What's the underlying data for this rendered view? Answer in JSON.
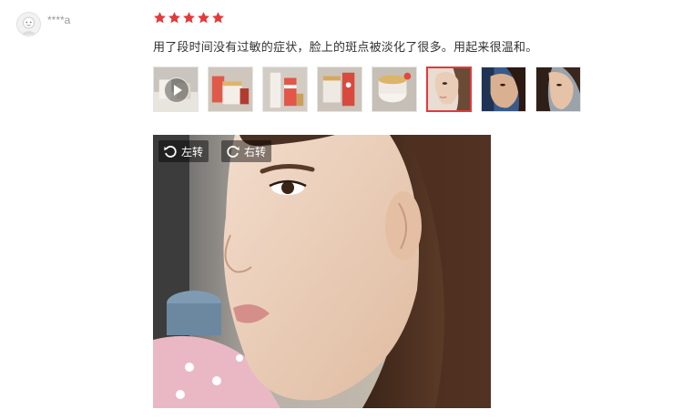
{
  "review": {
    "username": "****a",
    "rating": 5,
    "max_rating": 5,
    "star_color": "#e4393c",
    "comment": "用了段时间没有过敏的症状，脸上的斑点被淡化了很多。用起来很温和。",
    "thumbnails": [
      {
        "name": "thumb-video",
        "kind": "video"
      },
      {
        "name": "thumb-product-1",
        "kind": "image"
      },
      {
        "name": "thumb-product-2",
        "kind": "image"
      },
      {
        "name": "thumb-product-3",
        "kind": "image"
      },
      {
        "name": "thumb-product-4",
        "kind": "image"
      },
      {
        "name": "thumb-face-1",
        "kind": "image",
        "selected": true
      },
      {
        "name": "thumb-face-2",
        "kind": "image"
      },
      {
        "name": "thumb-face-3",
        "kind": "image"
      }
    ],
    "selected_thumb_color": "#e4393c"
  },
  "viewer": {
    "rotate_left_label": "左转",
    "rotate_right_label": "右转",
    "rotate_left_icon": "rotate-left-icon",
    "rotate_right_icon": "rotate-right-icon"
  }
}
